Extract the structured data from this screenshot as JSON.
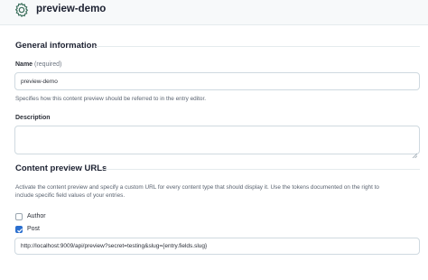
{
  "header": {
    "title": "preview-demo",
    "icon": "gear-icon"
  },
  "general": {
    "heading": "General information",
    "name_label": "Name",
    "name_required": "(required)",
    "name_value": "preview-demo",
    "name_help": "Specifies how this content preview should be referred to in the entry editor.",
    "description_label": "Description",
    "description_value": ""
  },
  "urls": {
    "heading": "Content preview URLs",
    "help_line1": "Activate the content preview and specify a custom URL for every content type that should display it. Use the tokens documented on the right to",
    "help_line2": "include specific field values of your entries.",
    "items": [
      {
        "label": "Author",
        "checked": false
      },
      {
        "label": "Post",
        "checked": true
      }
    ],
    "post_url": "http://localhost:9009/api/preview?secret=testing&slug={entry.fields.slug}"
  },
  "colors": {
    "accent": "#2b6fcf",
    "border": "#cfd9e0",
    "topbar_bg": "#f7f9fa"
  }
}
